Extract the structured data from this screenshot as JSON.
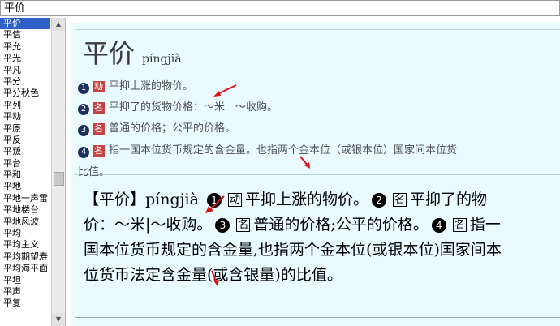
{
  "search": {
    "value": "平价"
  },
  "list": {
    "items": [
      "平价",
      "平信",
      "平允",
      "平光",
      "平凡",
      "平分",
      "平分秋色",
      "平列",
      "平动",
      "平原",
      "平反",
      "平叛",
      "平台",
      "平和",
      "平地",
      "平地一声雷",
      "平地楼台",
      "平地风波",
      "平均",
      "平均主义",
      "平均期望寿",
      "平均海平面",
      "平坦",
      "平声",
      "平复"
    ]
  },
  "entry": {
    "headword": "平价",
    "pinyin": "píngjià",
    "senses": [
      {
        "num": "1",
        "pos": "动",
        "text": "平抑上涨的物价。"
      },
      {
        "num": "2",
        "pos": "名",
        "text": "平抑了的货物价格：～米｜～收购。"
      },
      {
        "num": "3",
        "pos": "名",
        "text": "普通的价格；公平的价格。"
      },
      {
        "num": "4",
        "pos": "名",
        "text": "指一国本位货币规定的含金量。也指两个金本位（或银本位）国家间本位货"
      }
    ],
    "sense4_cont": "比值。"
  },
  "scan": {
    "head": "【平价】píngjià",
    "n1": "1",
    "p1": "动",
    "t1": "平抑上涨的物价。",
    "n2": "2",
    "p2": "名",
    "t2a": "平抑了的物价：～米|～收购。",
    "n3": "3",
    "p3": "名",
    "t3a": "普通的价格;公平的价格。",
    "n4": "4",
    "p4": "名",
    "t4a": "指一国本位货币规定的含金量,也指两个金本位(或银本位)国家间本位货币法定含金量(或含银量)的比值。"
  },
  "colors": {
    "accent": "#2f5fc8",
    "panel_bg": "#e9fbff",
    "pos_tag": "#c74343",
    "arrow": "#e01010"
  }
}
